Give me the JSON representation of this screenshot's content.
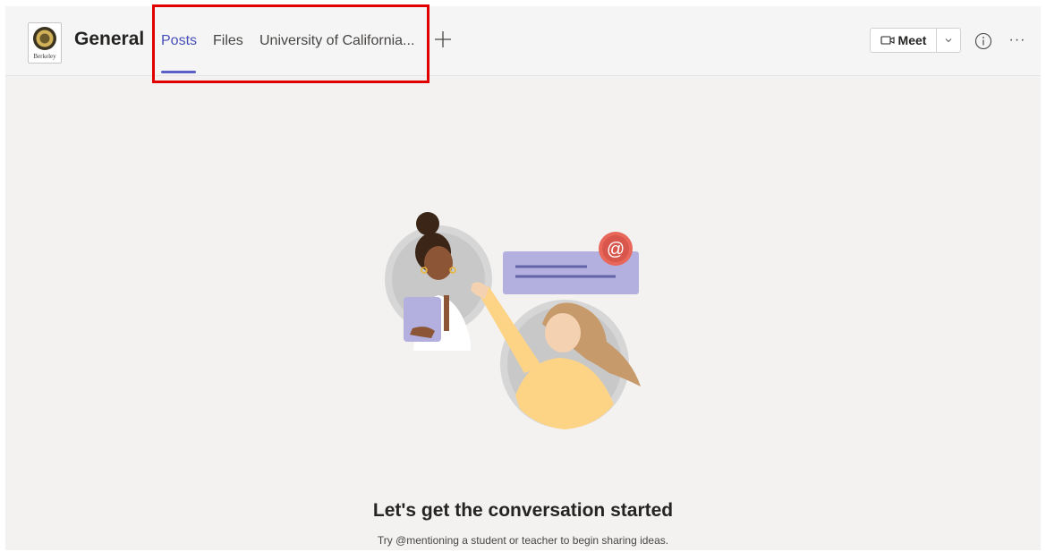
{
  "header": {
    "team_logo_caption": "Berkeley",
    "channel_name": "General",
    "tabs": [
      {
        "label": "Posts",
        "active": true
      },
      {
        "label": "Files",
        "active": false
      },
      {
        "label": "University of California...",
        "active": false
      }
    ],
    "add_tab_icon": "plus-icon",
    "meet_label": "Meet",
    "meet_icon": "video-camera-icon",
    "meet_dropdown_icon": "chevron-down-icon",
    "info_icon": "info-icon",
    "more_icon": "more-options-icon",
    "more_glyph": "···"
  },
  "annotation": {
    "highlight_color": "#e00000"
  },
  "empty_state": {
    "title": "Let's get the conversation started",
    "subtitle": "Try @mentioning a student or teacher to begin sharing ideas.",
    "illustration_icon": "at-mention-badge-icon"
  },
  "colors": {
    "accent": "#5b5fc7",
    "background": "#f3f2f1",
    "mention_badge": "#e8675a",
    "message_card": "#b3b0e0"
  }
}
